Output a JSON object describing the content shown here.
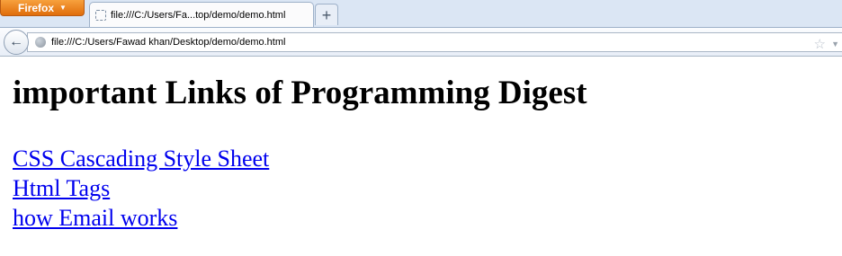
{
  "browser": {
    "menu_button": "Firefox",
    "tab": {
      "title": "file:///C:/Users/Fa...top/demo/demo.html"
    },
    "newtab_label": "+",
    "url": "file:///C:/Users/Fawad khan/Desktop/demo/demo.html"
  },
  "page": {
    "heading": "important Links of Programming Digest",
    "links": [
      "CSS Cascading Style Sheet",
      "Html Tags",
      "how Email works"
    ]
  },
  "colors": {
    "link": "#0000ee",
    "firefox_orange": "#e8770f"
  }
}
